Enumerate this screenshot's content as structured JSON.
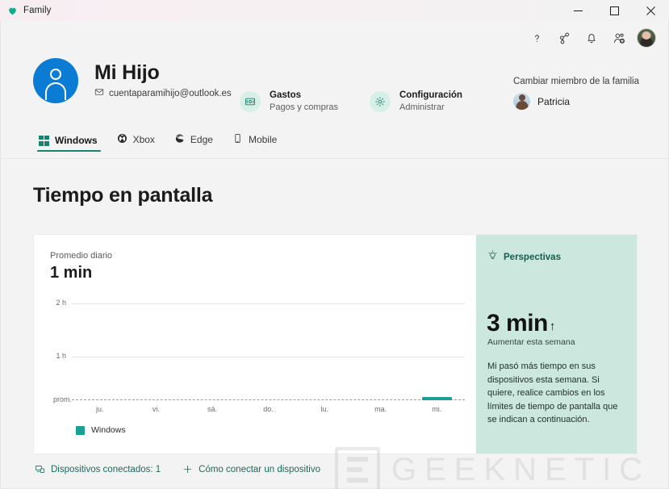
{
  "window": {
    "title": "Family",
    "app_icon": "heart-icon",
    "controls": {
      "minimize": "minimize-icon",
      "maximize": "maximize-icon",
      "close": "close-icon"
    }
  },
  "command_bar": {
    "items": [
      {
        "name": "help-icon",
        "glyph": "?"
      },
      {
        "name": "share-icon",
        "glyph": ""
      },
      {
        "name": "notifications-bell-icon",
        "glyph": ""
      },
      {
        "name": "add-family-member-icon",
        "glyph": ""
      }
    ],
    "avatar_name": "account-avatar"
  },
  "profile": {
    "avatar": "person-avatar",
    "name": "Mi Hijo",
    "email": "cuentaparamihijo@outlook.es",
    "mail_icon": "envelope-icon"
  },
  "actions": [
    {
      "icon": "wallet-icon",
      "title": "Gastos",
      "subtitle": "Pagos y compras"
    },
    {
      "icon": "gear-icon",
      "title": "Configuración",
      "subtitle": "Administrar"
    }
  ],
  "member_switch": {
    "label": "Cambiar miembro de la familia",
    "member": "Patricia",
    "avatar": "patricia-avatar"
  },
  "tabs": [
    {
      "label": "Windows",
      "icon": "windows-icon",
      "active": true
    },
    {
      "label": "Xbox",
      "icon": "xbox-icon",
      "active": false
    },
    {
      "label": "Edge",
      "icon": "edge-icon",
      "active": false
    },
    {
      "label": "Mobile",
      "icon": "phone-icon",
      "active": false
    }
  ],
  "page": {
    "title": "Tiempo en pantalla"
  },
  "card": {
    "average_label": "Promedio diario",
    "average_value": "1 min",
    "legend": [
      {
        "label": "Windows",
        "color": "#17a093"
      }
    ]
  },
  "insights": {
    "icon": "lightbulb-icon",
    "heading": "Perspectivas",
    "value": "3 min",
    "trend_arrow": "↑",
    "subtitle": "Aumentar esta semana",
    "body": "Mi pasó más tiempo en sus dispositivos esta semana. Si quiere, realice cambios en los límites de tiempo de pantalla que se indican a continuación."
  },
  "footer": {
    "devices": {
      "icon": "devices-icon",
      "label": "Dispositivos conectados: 1"
    },
    "connect": {
      "icon": "plus-icon",
      "label": "Cómo conectar un dispositivo"
    }
  },
  "watermark": {
    "text": "GEEKNETIC"
  },
  "colors": {
    "accent_teal": "#17a093",
    "tab_underline": "#17826f",
    "insights_bg": "#cce8de",
    "link_green": "#1b6b5a",
    "profile_blue": "#0a7cd4"
  },
  "chart_data": {
    "type": "bar",
    "title": "Tiempo en pantalla",
    "categories": [
      "ju.",
      "vi.",
      "sá.",
      "do.",
      "lu.",
      "ma.",
      "mi."
    ],
    "series": [
      {
        "name": "Windows",
        "color": "#17a093",
        "values": [
          0,
          0,
          0,
          0,
          0,
          0,
          3
        ]
      }
    ],
    "values": [
      0,
      0,
      0,
      0,
      0,
      0,
      3
    ],
    "unit": "min",
    "ylabel": "",
    "xlabel": "",
    "ylim": [
      0,
      120
    ],
    "yticks": [
      60,
      120
    ],
    "ytick_labels": [
      "1 h",
      "2 h"
    ],
    "average_line": {
      "label": "prom.",
      "value": 1,
      "style": "dashed"
    },
    "grid": true,
    "legend_position": "bottom-left"
  }
}
